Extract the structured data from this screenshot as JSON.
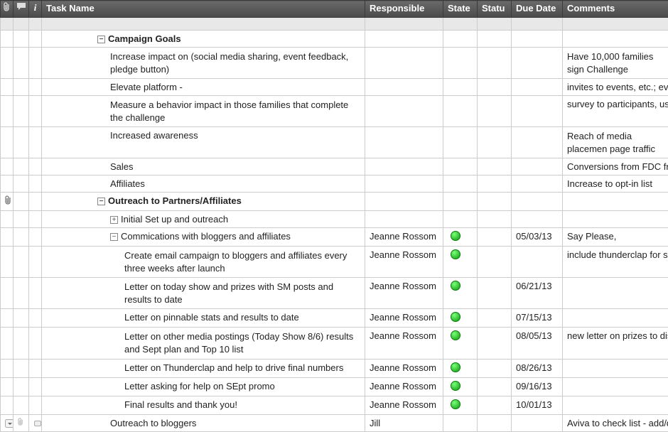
{
  "columns": {
    "attach": "",
    "comment": "",
    "info": "i",
    "task": "Task Name",
    "responsible": "Responsible",
    "state": "State",
    "statu": "Statu",
    "due": "Due Date",
    "comments": "Comments"
  },
  "rows": [
    {
      "type": "section",
      "indent": 1,
      "expand": "minus",
      "task": "Campaign Goals"
    },
    {
      "type": "task",
      "indent": 2,
      "task": "Increase impact on (social media sharing, event feedback, pledge button)",
      "wrap": true,
      "comments": "Have 10,000 families sign Challenge",
      "commentsWrap": true
    },
    {
      "type": "task",
      "indent": 2,
      "task": "Elevate platform -",
      "comments": "invites to events, etc.; ev"
    },
    {
      "type": "task",
      "indent": 2,
      "task": "Measure a behavior impact in those families that complete the challenge",
      "wrap": true,
      "comments": "survey to participants, us"
    },
    {
      "type": "task",
      "indent": 2,
      "task": "Increased awareness",
      "comments": "Reach of media placemen page traffic",
      "commentsWrap": true
    },
    {
      "type": "task",
      "indent": 2,
      "task": "Sales",
      "comments": "Conversions from FDC fre"
    },
    {
      "type": "task",
      "indent": 2,
      "task": "Affiliates",
      "comments": "Increase to opt-in list"
    },
    {
      "type": "section",
      "indent": 1,
      "expand": "minus",
      "task": "Outreach to Partners/Affiliates",
      "attach": true
    },
    {
      "type": "subsection",
      "indent": 2,
      "expand": "plus",
      "task": "Initial Set up and outreach"
    },
    {
      "type": "subsection",
      "indent": 2,
      "expand": "minus",
      "task": "Commications with bloggers and affiliates",
      "responsible": "Jeanne Rossom",
      "state": "green",
      "due": "05/03/13",
      "comments": "Say Please,"
    },
    {
      "type": "task",
      "indent": 3,
      "task": "Create email campaign to bloggers and affiliates every three weeks after launch",
      "wrap": true,
      "responsible": "Jeanne Rossom",
      "state": "green",
      "comments": "include thunderclap for se"
    },
    {
      "type": "task",
      "indent": 3,
      "task": "Letter on today show and prizes with SM posts and results to date",
      "wrap": true,
      "responsible": "Jeanne Rossom",
      "state": "green",
      "due": "06/21/13"
    },
    {
      "type": "task",
      "indent": 3,
      "task": "Letter on pinnable stats and results to date",
      "responsible": "Jeanne Rossom",
      "state": "green",
      "due": "07/15/13"
    },
    {
      "type": "task",
      "indent": 3,
      "task": "Letter on other media postings (Today Show 8/6) results and Sept plan and Top 10 list",
      "wrap": true,
      "responsible": "Jeanne Rossom",
      "state": "green",
      "due": "08/05/13",
      "comments": "new letter on prizes to dis"
    },
    {
      "type": "task",
      "indent": 3,
      "task": "Letter on Thunderclap and help to drive final numbers",
      "responsible": "Jeanne Rossom",
      "state": "green",
      "due": "08/26/13"
    },
    {
      "type": "task",
      "indent": 3,
      "task": "Letter asking for help on SEpt promo",
      "responsible": "Jeanne Rossom",
      "state": "green",
      "due": "09/16/13"
    },
    {
      "type": "task",
      "indent": 3,
      "task": "Final results and thank you!",
      "responsible": "Jeanne Rossom",
      "state": "green",
      "due": "10/01/13"
    },
    {
      "type": "task",
      "indent": 2,
      "task": "Outreach to bloggers",
      "responsible": "Jill",
      "comments": "Aviva to check list - add/d",
      "rowControls": true
    }
  ]
}
